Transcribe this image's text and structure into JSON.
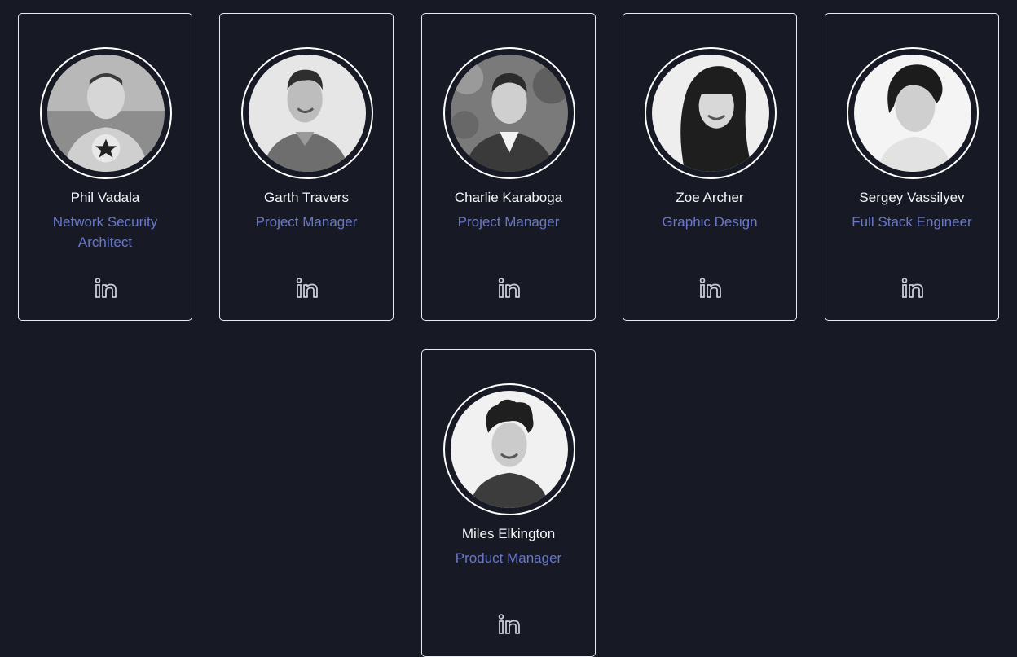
{
  "team": [
    {
      "name": "Phil Vadala",
      "role": "Network Security Architect",
      "linkedin_icon": "linkedin-icon",
      "photo": "profile-photo"
    },
    {
      "name": "Garth Travers",
      "role": "Project Manager",
      "linkedin_icon": "linkedin-icon",
      "photo": "profile-photo"
    },
    {
      "name": "Charlie Karaboga",
      "role": "Project Manager",
      "linkedin_icon": "linkedin-icon",
      "photo": "profile-photo"
    },
    {
      "name": "Zoe Archer",
      "role": "Graphic Design",
      "linkedin_icon": "linkedin-icon",
      "photo": "profile-photo"
    },
    {
      "name": "Sergey Vassilyev",
      "role": "Full Stack Engineer",
      "linkedin_icon": "linkedin-icon",
      "photo": "profile-photo"
    },
    {
      "name": "Miles Elkington",
      "role": "Product Manager",
      "linkedin_icon": "linkedin-icon",
      "photo": "profile-photo"
    }
  ],
  "colors": {
    "background": "#171a25",
    "card_border": "#e9ebf2",
    "name_text": "#f3f4f8",
    "role_text": "#6a77c8",
    "icon": "#c9ccd6"
  }
}
